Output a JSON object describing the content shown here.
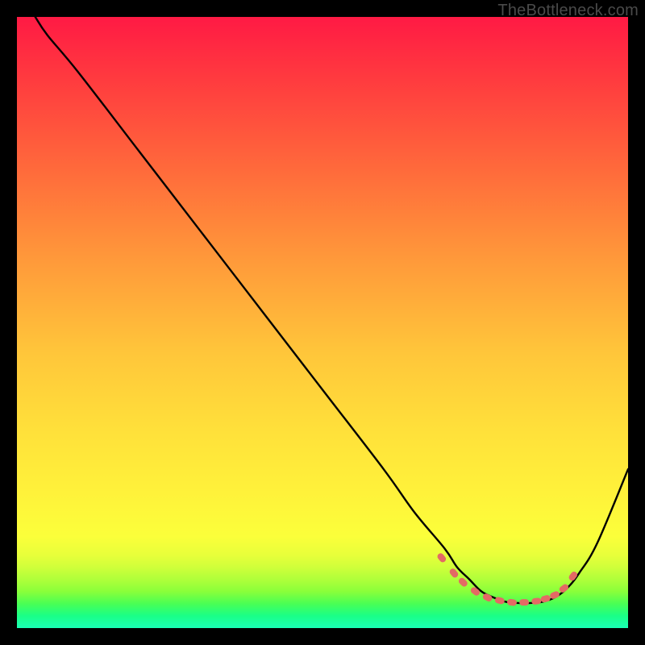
{
  "watermark": "TheBottleneck.com",
  "chart_data": {
    "type": "line",
    "title": "",
    "xlabel": "",
    "ylabel": "",
    "xlim": [
      0,
      100
    ],
    "ylim": [
      0,
      100
    ],
    "grid": false,
    "legend": false,
    "series": [
      {
        "name": "curve",
        "x": [
          3,
          5,
          10,
          20,
          30,
          40,
          50,
          60,
          65,
          70,
          72,
          74,
          76,
          78,
          80,
          82,
          84,
          86,
          88,
          90,
          92,
          95,
          100
        ],
        "values": [
          100,
          97,
          91,
          78,
          65,
          52,
          39,
          26,
          19,
          13,
          10,
          8,
          6,
          5,
          4.3,
          4.1,
          4.1,
          4.3,
          5,
          6.5,
          9,
          14,
          26
        ]
      },
      {
        "name": "dots",
        "x": [
          69.5,
          71.5,
          73,
          75,
          77,
          79,
          81,
          83,
          85,
          86.5,
          88,
          89.5,
          91
        ],
        "values": [
          11.5,
          9,
          7.5,
          6,
          5,
          4.5,
          4.2,
          4.2,
          4.4,
          4.8,
          5.4,
          6.5,
          8.5
        ]
      }
    ],
    "colors": {
      "curve": "#000000",
      "dots": "#e36a64"
    }
  }
}
